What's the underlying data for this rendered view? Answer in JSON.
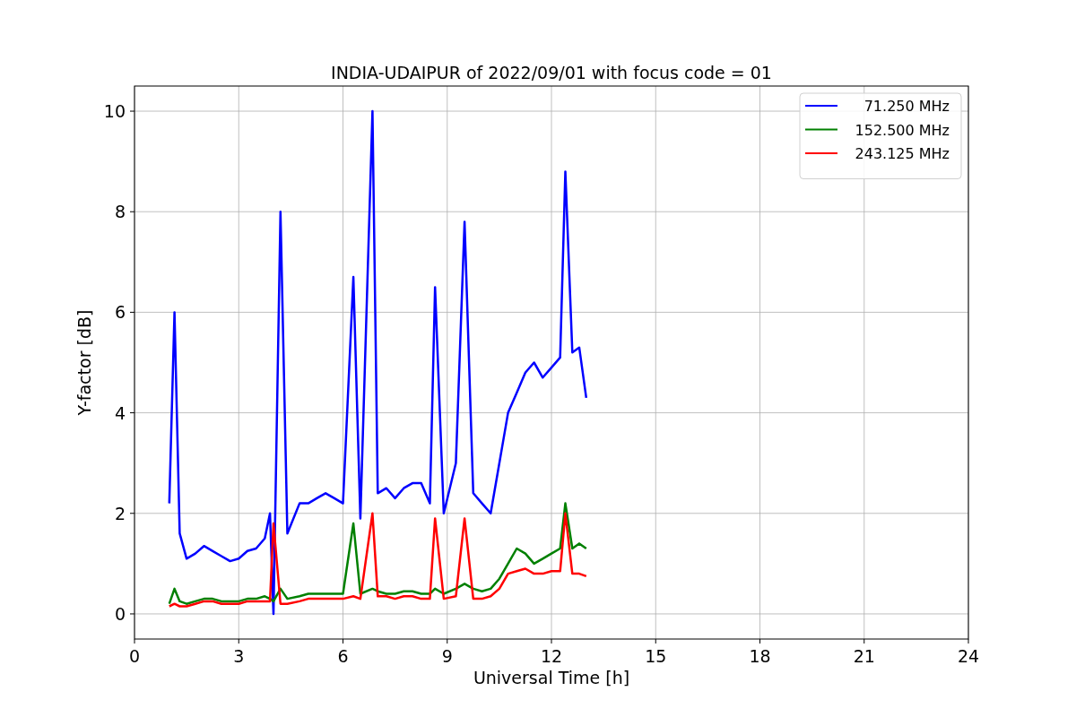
{
  "figure": {
    "chart_data": {
      "type": "line",
      "title": "INDIA-UDAIPUR of 2022/09/01 with focus code = 01",
      "xlabel": "Universal Time [h]",
      "ylabel": "Y-factor [dB]",
      "grid": true,
      "legend": true,
      "xlim": [
        0,
        24
      ],
      "ylim": [
        -0.5,
        10.5
      ],
      "xticks": [
        0,
        3,
        6,
        9,
        12,
        15,
        18,
        21,
        24
      ],
      "yticks": [
        0,
        2,
        4,
        6,
        8,
        10
      ],
      "x": [
        1,
        1.15,
        1.3,
        1.5,
        1.75,
        2,
        2.25,
        2.5,
        2.75,
        3,
        3.25,
        3.5,
        3.75,
        3.9,
        4,
        4.2,
        4.4,
        4.75,
        5,
        5.25,
        5.5,
        5.75,
        6,
        6.3,
        6.5,
        6.85,
        7,
        7.25,
        7.5,
        7.75,
        8,
        8.25,
        8.5,
        8.65,
        8.9,
        9.25,
        9.5,
        9.75,
        10,
        10.25,
        10.5,
        10.75,
        11,
        11.25,
        11.5,
        11.75,
        12,
        12.25,
        12.4,
        12.6,
        12.8,
        13
      ],
      "series": [
        {
          "name": "71.250 MHz",
          "color": "#0000ff",
          "values": [
            2.2,
            6.0,
            1.6,
            1.1,
            1.2,
            1.35,
            1.25,
            1.15,
            1.05,
            1.1,
            1.25,
            1.3,
            1.5,
            2.0,
            0.0,
            8.0,
            1.6,
            2.2,
            2.2,
            2.3,
            2.4,
            2.3,
            2.2,
            6.7,
            1.9,
            10.0,
            2.4,
            2.5,
            2.3,
            2.5,
            2.6,
            2.6,
            2.2,
            6.5,
            2.0,
            3.0,
            7.8,
            2.4,
            2.2,
            2.0,
            3.0,
            4.0,
            4.4,
            4.8,
            5.0,
            4.7,
            4.9,
            5.1,
            8.8,
            5.2,
            5.3,
            4.3
          ]
        },
        {
          "name": "152.500 MHz",
          "color": "#008000",
          "values": [
            0.2,
            0.5,
            0.25,
            0.2,
            0.25,
            0.3,
            0.3,
            0.25,
            0.25,
            0.25,
            0.3,
            0.3,
            0.35,
            0.3,
            0.25,
            0.5,
            0.3,
            0.35,
            0.4,
            0.4,
            0.4,
            0.4,
            0.4,
            1.8,
            0.4,
            0.5,
            0.45,
            0.4,
            0.4,
            0.45,
            0.45,
            0.4,
            0.4,
            0.5,
            0.4,
            0.5,
            0.6,
            0.5,
            0.45,
            0.5,
            0.7,
            1.0,
            1.3,
            1.2,
            1.0,
            1.1,
            1.2,
            1.3,
            2.2,
            1.3,
            1.4,
            1.3
          ]
        },
        {
          "name": "243.125 MHz",
          "color": "#ff0000",
          "values": [
            0.15,
            0.2,
            0.15,
            0.15,
            0.2,
            0.25,
            0.25,
            0.2,
            0.2,
            0.2,
            0.25,
            0.25,
            0.25,
            0.25,
            1.8,
            0.2,
            0.2,
            0.25,
            0.3,
            0.3,
            0.3,
            0.3,
            0.3,
            0.35,
            0.3,
            2.0,
            0.35,
            0.35,
            0.3,
            0.35,
            0.35,
            0.3,
            0.3,
            1.9,
            0.3,
            0.35,
            1.9,
            0.3,
            0.3,
            0.35,
            0.5,
            0.8,
            0.85,
            0.9,
            0.8,
            0.8,
            0.85,
            0.85,
            2.0,
            0.8,
            0.8,
            0.75
          ]
        }
      ]
    }
  }
}
